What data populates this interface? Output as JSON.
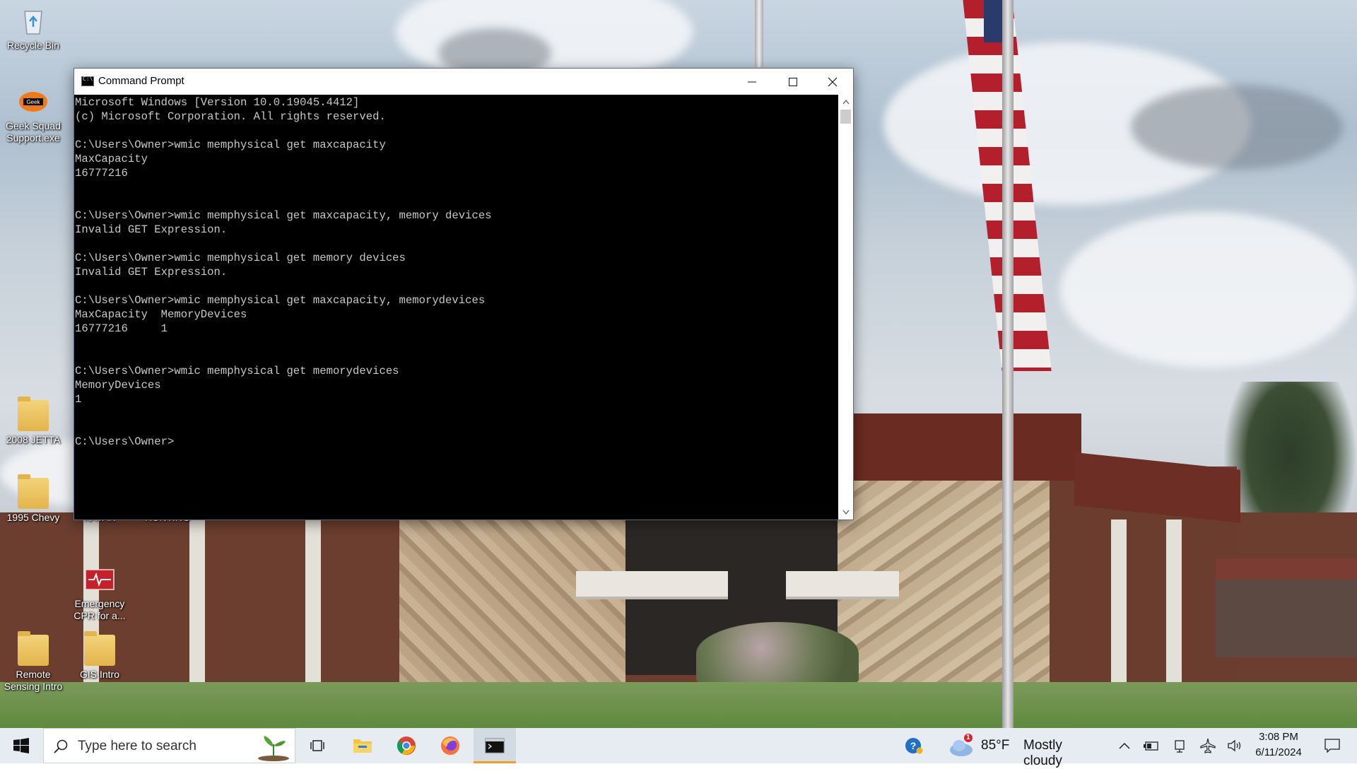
{
  "desktop": {
    "icons": [
      {
        "label": "Recycle Bin",
        "icon": "recycle-bin-icon"
      },
      {
        "label": "Geek Squad Support.exe",
        "icon": "geek-squad-icon"
      },
      {
        "label": "2008 JETTA",
        "icon": "folder-icon"
      },
      {
        "label": "1995 Chevy",
        "icon": "folder-icon"
      },
      {
        "label": "KAYAK",
        "icon": "folder-icon"
      },
      {
        "label": "HUNTING",
        "icon": "folder-icon"
      },
      {
        "label": "Emergency CPR for a...",
        "icon": "video-file-icon"
      },
      {
        "label": "Remote Sensing Intro",
        "icon": "folder-icon"
      },
      {
        "label": "GIS Intro",
        "icon": "folder-icon"
      }
    ]
  },
  "cmd": {
    "title": "Command Prompt",
    "lines": [
      "Microsoft Windows [Version 10.0.19045.4412]",
      "(c) Microsoft Corporation. All rights reserved.",
      "",
      "C:\\Users\\Owner>wmic memphysical get maxcapacity",
      "MaxCapacity",
      "16777216",
      "",
      "",
      "C:\\Users\\Owner>wmic memphysical get maxcapacity, memory devices",
      "Invalid GET Expression.",
      "",
      "C:\\Users\\Owner>wmic memphysical get memory devices",
      "Invalid GET Expression.",
      "",
      "C:\\Users\\Owner>wmic memphysical get maxcapacity, memorydevices",
      "MaxCapacity  MemoryDevices",
      "16777216     1",
      "",
      "",
      "C:\\Users\\Owner>wmic memphysical get memorydevices",
      "MemoryDevices",
      "1",
      "",
      "",
      "C:\\Users\\Owner>"
    ]
  },
  "taskbar": {
    "search_placeholder": "Type here to search",
    "pinned": [
      "task-view-icon",
      "file-explorer-icon",
      "chrome-icon",
      "firefox-icon",
      "command-prompt-icon"
    ],
    "weather": {
      "badge": "1",
      "temp": "85°F",
      "condition": "Mostly cloudy"
    },
    "clock": {
      "time": "3:08 PM",
      "date": "6/11/2024"
    }
  },
  "colors": {
    "terminal_bg": "#000000",
    "terminal_fg": "#c8c8c8",
    "taskbar_bg": "#e6ecf1",
    "active_indicator": "#f0a020"
  }
}
